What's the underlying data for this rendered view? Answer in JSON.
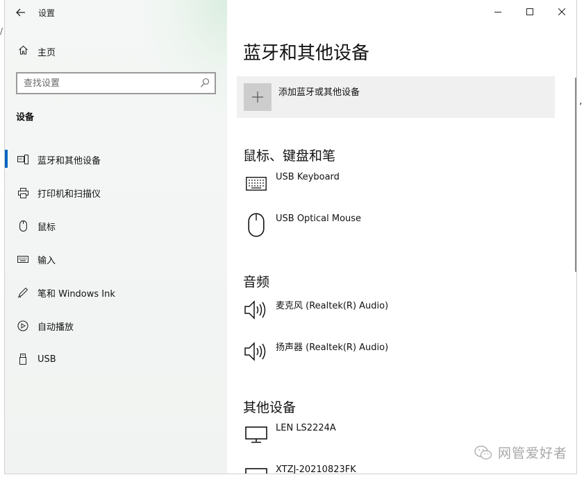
{
  "window": {
    "app_title": "设置",
    "back_icon": "arrow-left-icon",
    "controls": {
      "minimize_icon": "minimize-icon",
      "maximize_icon": "maximize-icon",
      "close_icon": "close-icon"
    }
  },
  "sidebar": {
    "home": {
      "label": "主页",
      "icon": "home-icon"
    },
    "search": {
      "placeholder": "查找设置",
      "icon": "search-icon"
    },
    "section_title": "设备",
    "items": [
      {
        "label": "蓝牙和其他设备",
        "icon": "bluetooth-devices-icon",
        "active": true
      },
      {
        "label": "打印机和扫描仪",
        "icon": "printer-icon",
        "active": false
      },
      {
        "label": "鼠标",
        "icon": "mouse-icon",
        "active": false
      },
      {
        "label": "输入",
        "icon": "keyboard-icon",
        "active": false
      },
      {
        "label": "笔和 Windows Ink",
        "icon": "pen-icon",
        "active": false
      },
      {
        "label": "自动播放",
        "icon": "autoplay-icon",
        "active": false
      },
      {
        "label": "USB",
        "icon": "usb-icon",
        "active": false
      }
    ],
    "accent_color": "#0067c0"
  },
  "main": {
    "page_title": "蓝牙和其他设备",
    "add_device": {
      "label": "添加蓝牙或其他设备",
      "icon": "plus-icon"
    },
    "groups": [
      {
        "title": "鼠标、键盘和笔",
        "devices": [
          {
            "name": "USB Keyboard",
            "icon": "keyboard-icon"
          },
          {
            "name": "USB Optical Mouse",
            "icon": "mouse-icon"
          }
        ]
      },
      {
        "title": "音频",
        "devices": [
          {
            "name": "麦克风 (Realtek(R) Audio)",
            "icon": "speaker-icon"
          },
          {
            "name": "扬声器 (Realtek(R) Audio)",
            "icon": "speaker-icon"
          }
        ]
      },
      {
        "title": "其他设备",
        "devices": [
          {
            "name": "LEN LS2224A",
            "icon": "monitor-icon"
          },
          {
            "name": "XTZJ-20210823FK",
            "icon": "monitor-icon"
          }
        ]
      }
    ]
  },
  "watermark": {
    "text": "网管爱好者",
    "icon": "wechat-icon"
  },
  "stray": {
    "comma": ",",
    "slash": "/"
  }
}
